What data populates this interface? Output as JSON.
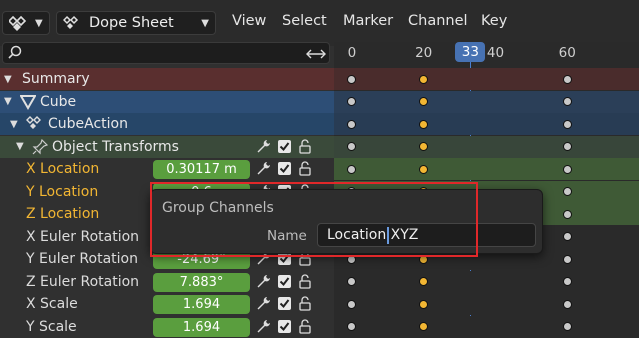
{
  "header": {
    "editor_type": "Dope Sheet",
    "menus": [
      "View",
      "Select",
      "Marker",
      "Channel",
      "Key"
    ]
  },
  "search": {
    "value": "",
    "placeholder": ""
  },
  "timeline": {
    "ticks": [
      "0",
      "20",
      "40",
      "60"
    ],
    "current_frame": "33",
    "frame_range": [
      -5,
      80
    ]
  },
  "channels": [
    {
      "label": "Summary",
      "type": "summary",
      "value": ""
    },
    {
      "label": "Cube",
      "type": "object",
      "value": ""
    },
    {
      "label": "CubeAction",
      "type": "action",
      "value": ""
    },
    {
      "label": "Object Transforms",
      "type": "group",
      "value": ""
    },
    {
      "label": "X Location",
      "type": "fcurve",
      "value": "0.30117 m",
      "selected": true
    },
    {
      "label": "Y Location",
      "type": "fcurve",
      "value": "0.6",
      "selected": true
    },
    {
      "label": "Z Location",
      "type": "fcurve",
      "value": "",
      "selected": true
    },
    {
      "label": "X Euler Rotation",
      "type": "fcurve",
      "value": ""
    },
    {
      "label": "Y Euler Rotation",
      "type": "fcurve",
      "value": "-24.69°"
    },
    {
      "label": "Z Euler Rotation",
      "type": "fcurve",
      "value": "7.883°"
    },
    {
      "label": "X Scale",
      "type": "fcurve",
      "value": "1.694"
    },
    {
      "label": "Y Scale",
      "type": "fcurve",
      "value": "1.694"
    }
  ],
  "keyframes_frames": [
    0,
    20,
    60
  ],
  "dialog": {
    "title": "Group Channels",
    "name_label": "Name",
    "name_value": "Location XYZ"
  },
  "colors": {
    "summary_bg": "#5a2f2f",
    "object_bg": "#2d4e76",
    "action_bg": "#264668",
    "group_bg": "#3a4a3a",
    "accent_blue": "#4772b3",
    "selected_key": "#f2b633",
    "value_green": "#5a9e3e",
    "highlight_red": "#e0282a"
  }
}
